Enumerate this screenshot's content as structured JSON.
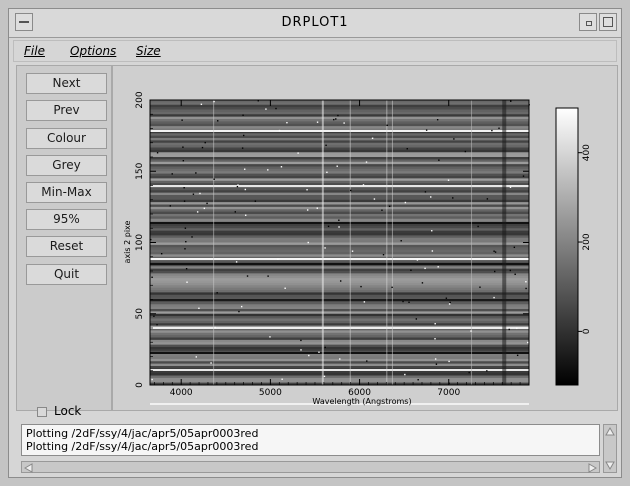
{
  "window": {
    "title": "DRPLOT1"
  },
  "menu": [
    {
      "label": "File"
    },
    {
      "label": "Options"
    },
    {
      "label": "Size"
    }
  ],
  "controls": [
    {
      "label": "Next"
    },
    {
      "label": "Prev"
    },
    {
      "label": "Colour"
    },
    {
      "label": "Grey"
    },
    {
      "label": "Min-Max"
    },
    {
      "label": "95%"
    },
    {
      "label": "Reset"
    },
    {
      "label": "Quit"
    }
  ],
  "lock": {
    "label": "Lock",
    "checked": false
  },
  "plot": {
    "xlabel": "Wavelength (Angstroms)",
    "ylabel": "axis 2 pixe",
    "x_ticks": [
      "4000",
      "5000",
      "6000",
      "7000"
    ],
    "y_ticks": [
      "0",
      "50",
      "100",
      "150",
      "200"
    ],
    "colorbar_ticks": [
      "0",
      "200",
      "400"
    ],
    "xlim": [
      3650,
      7900
    ],
    "ylim": [
      0,
      200
    ],
    "colorbar_range": [
      -120,
      500
    ]
  },
  "log": {
    "lines": [
      "Plotting /2dF/ssy/4/jac/apr5/05apr0003red",
      "Plotting /2dF/ssy/4/jac/apr5/05apr0003red"
    ]
  }
}
